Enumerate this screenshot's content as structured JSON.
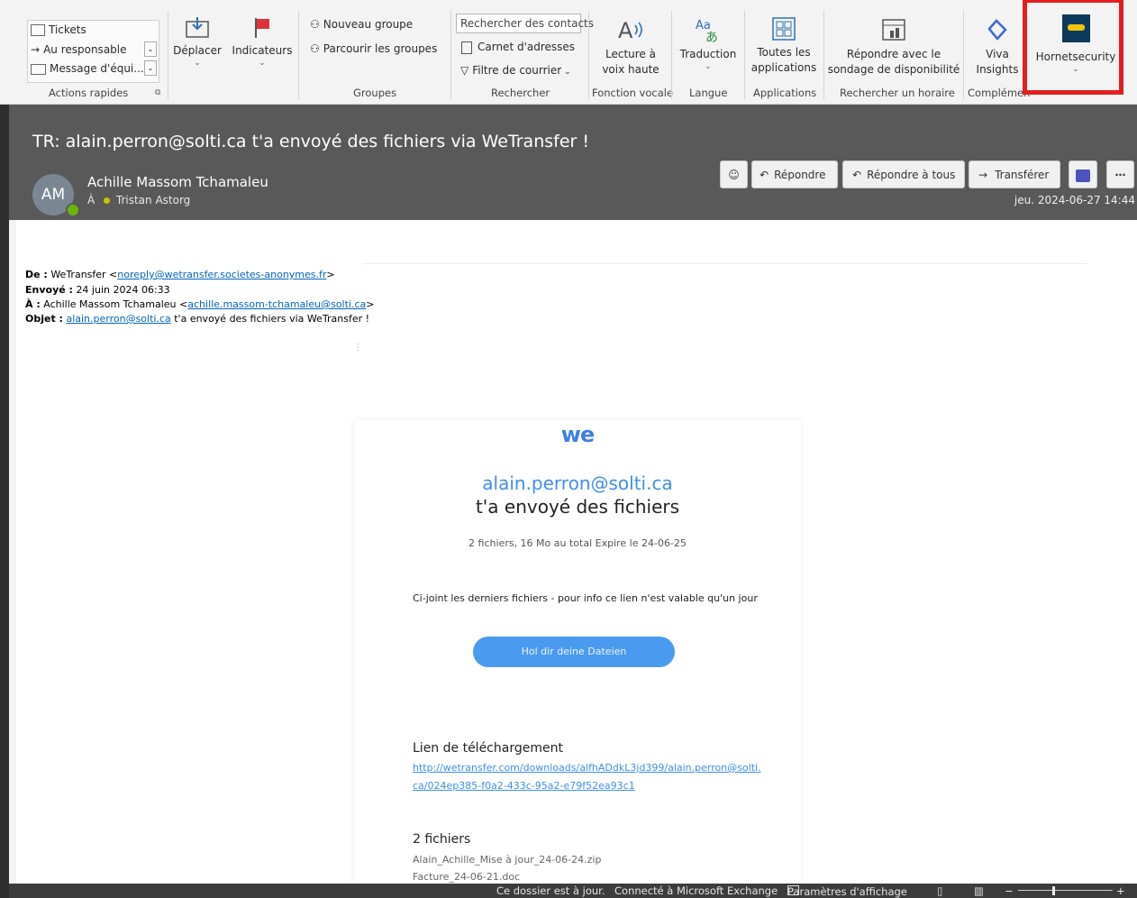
{
  "ribbon": {
    "quick_steps": {
      "items": [
        "Tickets",
        "Au responsable",
        "Message d'équi..."
      ],
      "group": "Actions rapides"
    },
    "move_label": "Déplacer",
    "flags_label": "Indicateurs",
    "groups": {
      "new_group": "Nouveau groupe",
      "browse_groups": "Parcourir les groupes",
      "group": "Groupes"
    },
    "search": {
      "placeholder": "Rechercher des contacts",
      "address_book": "Carnet d'adresses",
      "filter_mail": "Filtre de courrier",
      "group": "Rechercher"
    },
    "voice": {
      "read_aloud_line1": "Lecture à",
      "read_aloud_line2": "voix haute",
      "group": "Fonction vocale"
    },
    "language": {
      "translate": "Traduction",
      "group": "Langue"
    },
    "apps": {
      "all_apps_line1": "Toutes les",
      "all_apps_line2": "applications",
      "group": "Applications"
    },
    "schedule": {
      "reply_poll_line1": "Répondre avec le",
      "reply_poll_line2": "sondage de disponibilité",
      "group": "Rechercher un horaire"
    },
    "addins": {
      "viva_line1": "Viva",
      "viva_line2": "Insights",
      "group": "Complémen"
    },
    "hornetsecurity": "Hornetsecurity"
  },
  "message": {
    "subject": "TR: alain.perron@solti.ca t'a envoyé des fichiers via WeTransfer !",
    "avatar_initials": "AM",
    "sender": "Achille Massom Tchamaleu",
    "to_prefix": "À",
    "to": "Tristan Astorg",
    "datetime": "jeu. 2024-06-27 14:44",
    "actions": {
      "reply": "Répondre",
      "reply_all": "Répondre à tous",
      "forward": "Transférer"
    }
  },
  "forward_header": {
    "from_label": "De :",
    "from_name": "WeTransfer <",
    "from_email": "noreply@wetransfer.societes-anonymes.fr",
    "from_close": ">",
    "sent_label": "Envoyé :",
    "sent_value": "24 juin 2024 06:33",
    "to_label": "À :",
    "to_name": "Achille Massom Tchamaleu <",
    "to_email": "achille.massom-tchamaleu@solti.ca",
    "to_close": ">",
    "subject_label": "Objet :",
    "subject_link": "alain.perron@solti.ca",
    "subject_rest": " t'a envoyé des fichiers via WeTransfer !"
  },
  "card": {
    "logo": "we",
    "sender_email": "alain.perron@solti.ca",
    "headline": "t'a envoyé des fichiers",
    "summary": "2 fichiers, 16 Mo au total Expire le 24-06-25",
    "note": "Ci-joint les derniers fichiers - pour info ce lien n'est valable qu'un jour",
    "button": "Hol dir deine Dateien",
    "download_heading": "Lien de téléchargement",
    "download_link_line1": "http://wetransfer.com/downloads/alfhADdkL3jd399/alain.perron@solti.",
    "download_link_line2": "ca/024ep385-f0a2-433c-95a2-e79f52ea93c1",
    "files_heading": "2 fichiers",
    "files": [
      "Alain_Achille_Mise à jour_24-06-24.zip",
      "Facture_24-06-21.doc"
    ]
  },
  "status": {
    "folder": "Ce dossier est à jour.",
    "connection": "Connecté à Microsoft Exchange",
    "display_settings": "Paramètres d'affichage",
    "zoom_minus": "−",
    "zoom_plus": "+"
  }
}
